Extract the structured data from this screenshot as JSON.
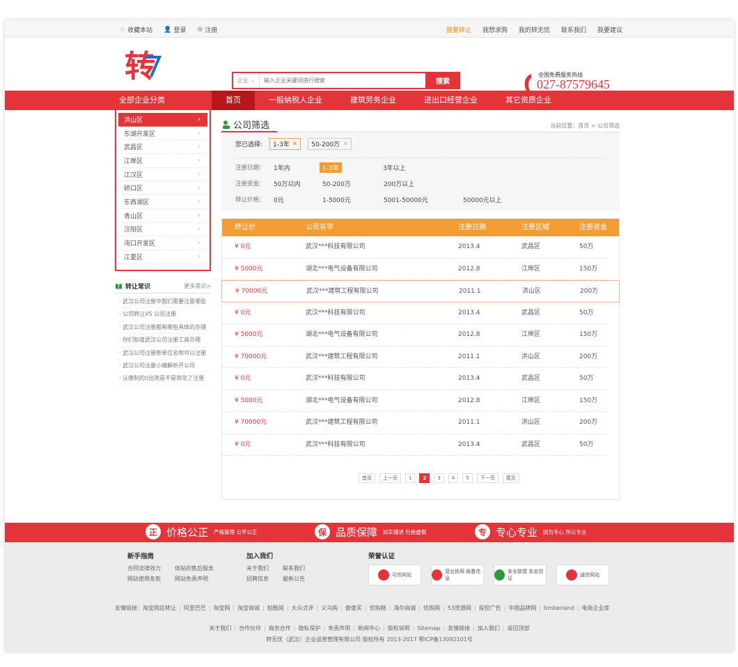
{
  "topbar": {
    "left": [
      {
        "icon": "star-icon",
        "label": "收藏本站"
      },
      {
        "icon": "user-icon",
        "label": "登录"
      },
      {
        "icon": "gear-icon",
        "label": "注册"
      }
    ],
    "right": [
      "我要转让",
      "我想求购",
      "我的转无忧",
      "联系我们",
      "我要建议"
    ]
  },
  "header": {
    "logo_text": "转",
    "search": {
      "select_value": "企业",
      "placeholder": "输入企业关键词进行搜索",
      "button": "搜索"
    },
    "hotline": {
      "label": "全国免费服务热线",
      "number": "027-87579645"
    }
  },
  "nav": {
    "category_label": "全部企业分类",
    "links": [
      "首页",
      "一般纳税人企业",
      "建筑劳务企业",
      "进出口经营企业",
      "其它资质企业"
    ],
    "active_index": 0
  },
  "sidebar": {
    "districts": [
      "洪山区",
      "东湖开发区",
      "武昌区",
      "江岸区",
      "江汉区",
      "硚口区",
      "东西湖区",
      "青山区",
      "汉阳区",
      "沌口开发区",
      "江夏区"
    ],
    "active_index": 0,
    "knowledge": {
      "title": "转让常识",
      "more": "更多常识>",
      "items": [
        "武汉公司注册中我们需要注意哪些",
        "公司转让VS 公司注册",
        "武汉公司注册都有哪些具体的办理",
        "你们知道武汉公司注册工商办理",
        "武汉公司注册称单位名称可以注册",
        "武汉公司注册小编解析开公司",
        "认缴制的0出资是不是简化了注册"
      ]
    }
  },
  "main": {
    "title": "公司筛选",
    "breadcrumb": "当前位置：首页 > 公司筛选",
    "selected_label": "您已选择:",
    "selected": [
      "1-3年",
      "50-200万"
    ],
    "filters": [
      {
        "label": "注册日期:",
        "options": [
          "1年内",
          "1-3年",
          "3年以上"
        ],
        "active": 1
      },
      {
        "label": "注册资金:",
        "options": [
          "50万以内",
          "50-200万",
          "200万以上"
        ],
        "active": -1
      },
      {
        "label": "转让价格:",
        "options": [
          "0元",
          "1-5000元",
          "5001-50000元",
          "50000元以上"
        ],
        "active": -1
      }
    ],
    "table": {
      "headers": [
        "转让价",
        "公司名字",
        "注册日期",
        "注册区域",
        "注册资金"
      ],
      "rows": [
        [
          "¥ 0元",
          "武汉***科技有限公司",
          "2013.4",
          "武昌区",
          "50万"
        ],
        [
          "¥ 5000元",
          "湖北***电气设备有限公司",
          "2012.8",
          "江岸区",
          "150万"
        ],
        [
          "¥ 70000元",
          "武汉***建筑工程有限公司",
          "2011.1",
          "洪山区",
          "200万"
        ],
        [
          "¥ 0元",
          "武汉***科技有限公司",
          "2013.4",
          "武昌区",
          "50万"
        ],
        [
          "¥ 5000元",
          "湖北***电气设备有限公司",
          "2012.8",
          "江岸区",
          "150万"
        ],
        [
          "¥ 70000元",
          "武汉***建筑工程有限公司",
          "2011.1",
          "洪山区",
          "200万"
        ],
        [
          "¥ 0元",
          "武汉***科技有限公司",
          "2013.4",
          "武昌区",
          "50万"
        ],
        [
          "¥ 5000元",
          "湖北***电气设备有限公司",
          "2012.8",
          "江岸区",
          "150万"
        ],
        [
          "¥ 70000元",
          "武汉***建筑工程有限公司",
          "2011.1",
          "洪山区",
          "200万"
        ],
        [
          "¥ 0元",
          "武汉***科技有限公司",
          "2013.4",
          "武昌区",
          "50万"
        ]
      ],
      "highlight_row": 2
    },
    "pager": {
      "items": [
        "首页",
        "上一页",
        "1",
        "2",
        "3",
        "4",
        "5",
        "下一页",
        "尾页"
      ],
      "active": "2"
    }
  },
  "footer": {
    "badges": [
      {
        "icon": "正",
        "title": "价格公正",
        "sub": "严格管理 公平公正"
      },
      {
        "icon": "保",
        "title": "品质保障",
        "sub": "如实描述 杜绝虚假"
      },
      {
        "icon": "专",
        "title": "专心专业",
        "sub": "因为专心 所以专业"
      }
    ],
    "guide": {
      "title": "新手指南",
      "rows": [
        [
          "合同法律效力",
          "体贴的售后服务"
        ],
        [
          "网站使用条款",
          "网站免责声明"
        ]
      ]
    },
    "join": {
      "title": "加入我们",
      "rows": [
        [
          "关于我们",
          "联系我们"
        ],
        [
          "招聘信息",
          "最新公告"
        ]
      ]
    },
    "honor": {
      "title": "荣誉认证",
      "items": [
        "可信网站",
        "营业执照 报备信息",
        "安全联盟 实名验证",
        "诚信网站"
      ]
    },
    "links_label": "友情链接：",
    "links": [
      "淘宝网店转让",
      "阿里巴巴",
      "淘宝网",
      "淘宝商城",
      "拍鞋网",
      "大众点评",
      "义乌购",
      "傻傻买",
      "优购物",
      "海尔商城",
      "优购网",
      "53货源网",
      "探挖广告",
      "中国品牌网",
      "timberland",
      "电商企业库"
    ],
    "about": [
      "关于我们",
      "合作伙伴",
      "商务合作",
      "隐私保护",
      "免责声明",
      "新闻中心",
      "版权说明",
      "Sitemap",
      "友情链接",
      "加入我们",
      "返回顶部"
    ],
    "copyright": "转无忧（武汉）企业运营管理有限公司 版权所有 2013-2017 鄂ICP备13092101号"
  }
}
